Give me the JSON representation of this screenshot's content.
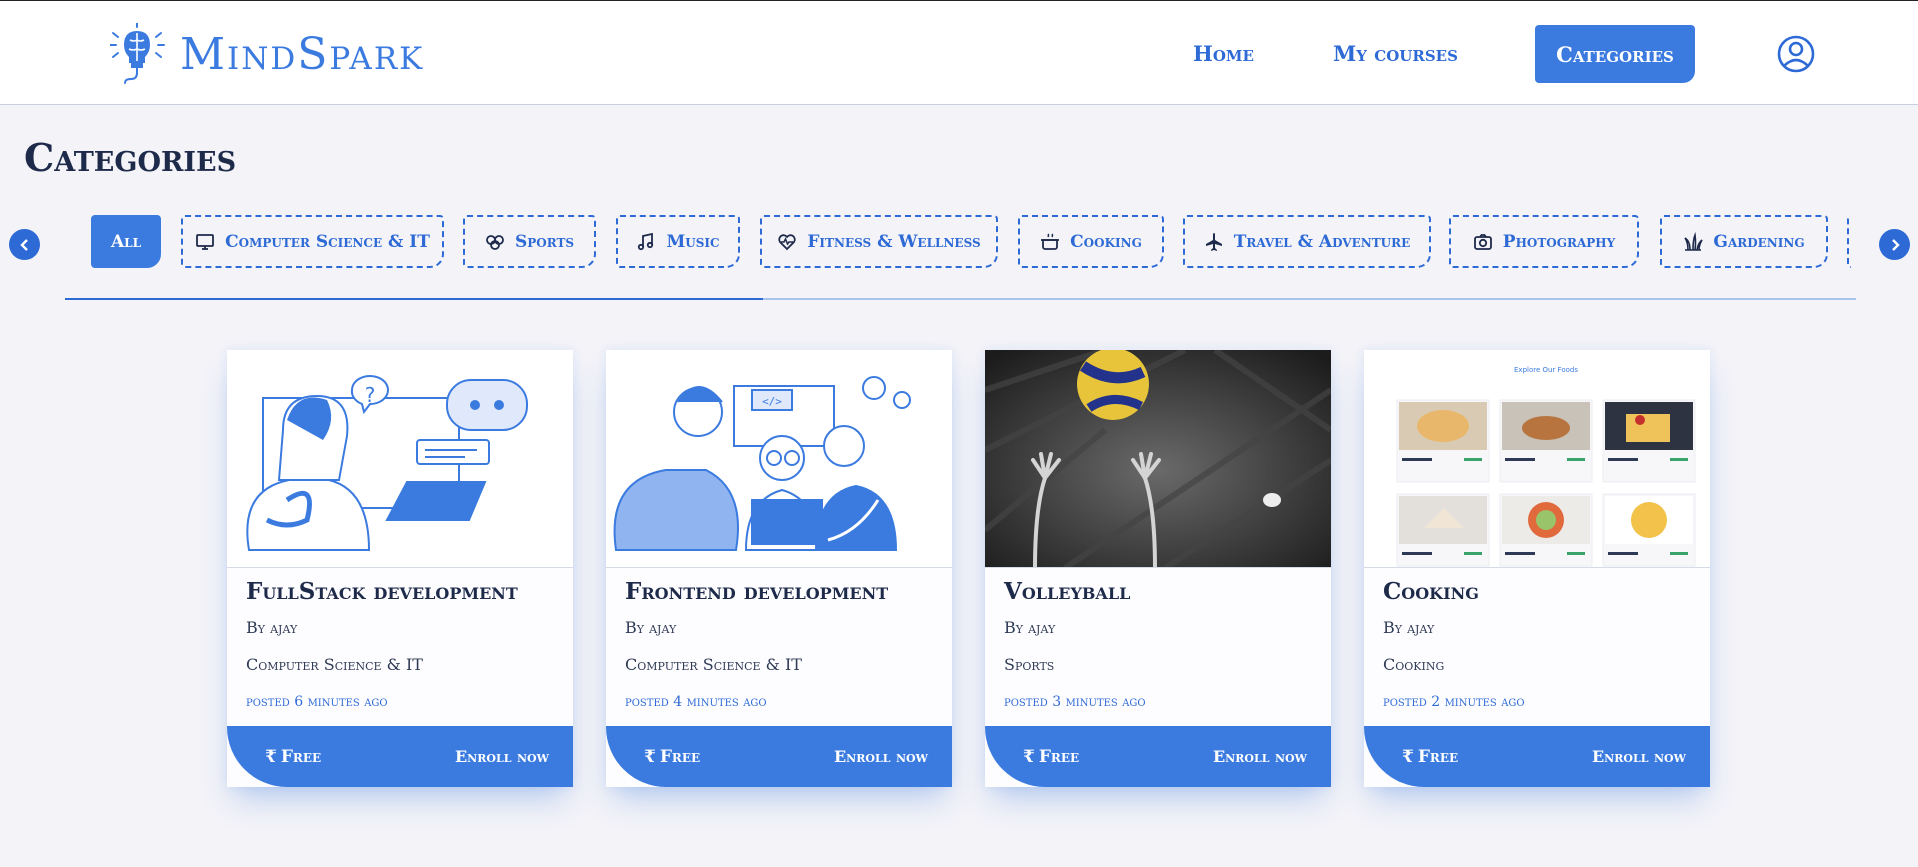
{
  "brand": {
    "name": "MindSpark",
    "color": "#3b7be0"
  },
  "nav": {
    "home": "Home",
    "my_courses": "My courses",
    "categories": "Categories",
    "profile_icon": "user-circle-icon"
  },
  "page": {
    "title": "Categories"
  },
  "categories": {
    "active": "All",
    "items": [
      {
        "label": "All",
        "icon": ""
      },
      {
        "label": "Computer Science & IT",
        "icon": "monitor-icon"
      },
      {
        "label": "Sports",
        "icon": "sports-icon"
      },
      {
        "label": "Music",
        "icon": "music-icon"
      },
      {
        "label": "Fitness & Wellness",
        "icon": "heart-pulse-icon"
      },
      {
        "label": "Cooking",
        "icon": "pot-icon"
      },
      {
        "label": "Travel & Adventure",
        "icon": "plane-icon"
      },
      {
        "label": "Photography",
        "icon": "camera-icon"
      },
      {
        "label": "Gardening",
        "icon": "plant-icon"
      }
    ],
    "scroll_progress": 0.39
  },
  "courses": [
    {
      "title": "FullStack development",
      "author": "By ajay",
      "category": "Computer Science & IT",
      "posted": "posted 6 minutes ago",
      "price": "Free",
      "cta": "Enroll now"
    },
    {
      "title": "Frontend development",
      "author": "By ajay",
      "category": "Computer Science & IT",
      "posted": "posted 4 minutes ago",
      "price": "Free",
      "cta": "Enroll now"
    },
    {
      "title": "Volleyball",
      "author": "By ajay",
      "category": "Sports",
      "posted": "posted 3 minutes ago",
      "price": "Free",
      "cta": "Enroll now"
    },
    {
      "title": "Cooking",
      "author": "By ajay",
      "category": "Cooking",
      "posted": "posted 2 minutes ago",
      "price": "Free",
      "cta": "Enroll now"
    }
  ],
  "thumb_texts": {
    "cooking_header": "Explore Our Foods"
  },
  "colors": {
    "accent": "#3b7be0",
    "dark": "#1e2a4a",
    "background": "#f3f3f8"
  }
}
